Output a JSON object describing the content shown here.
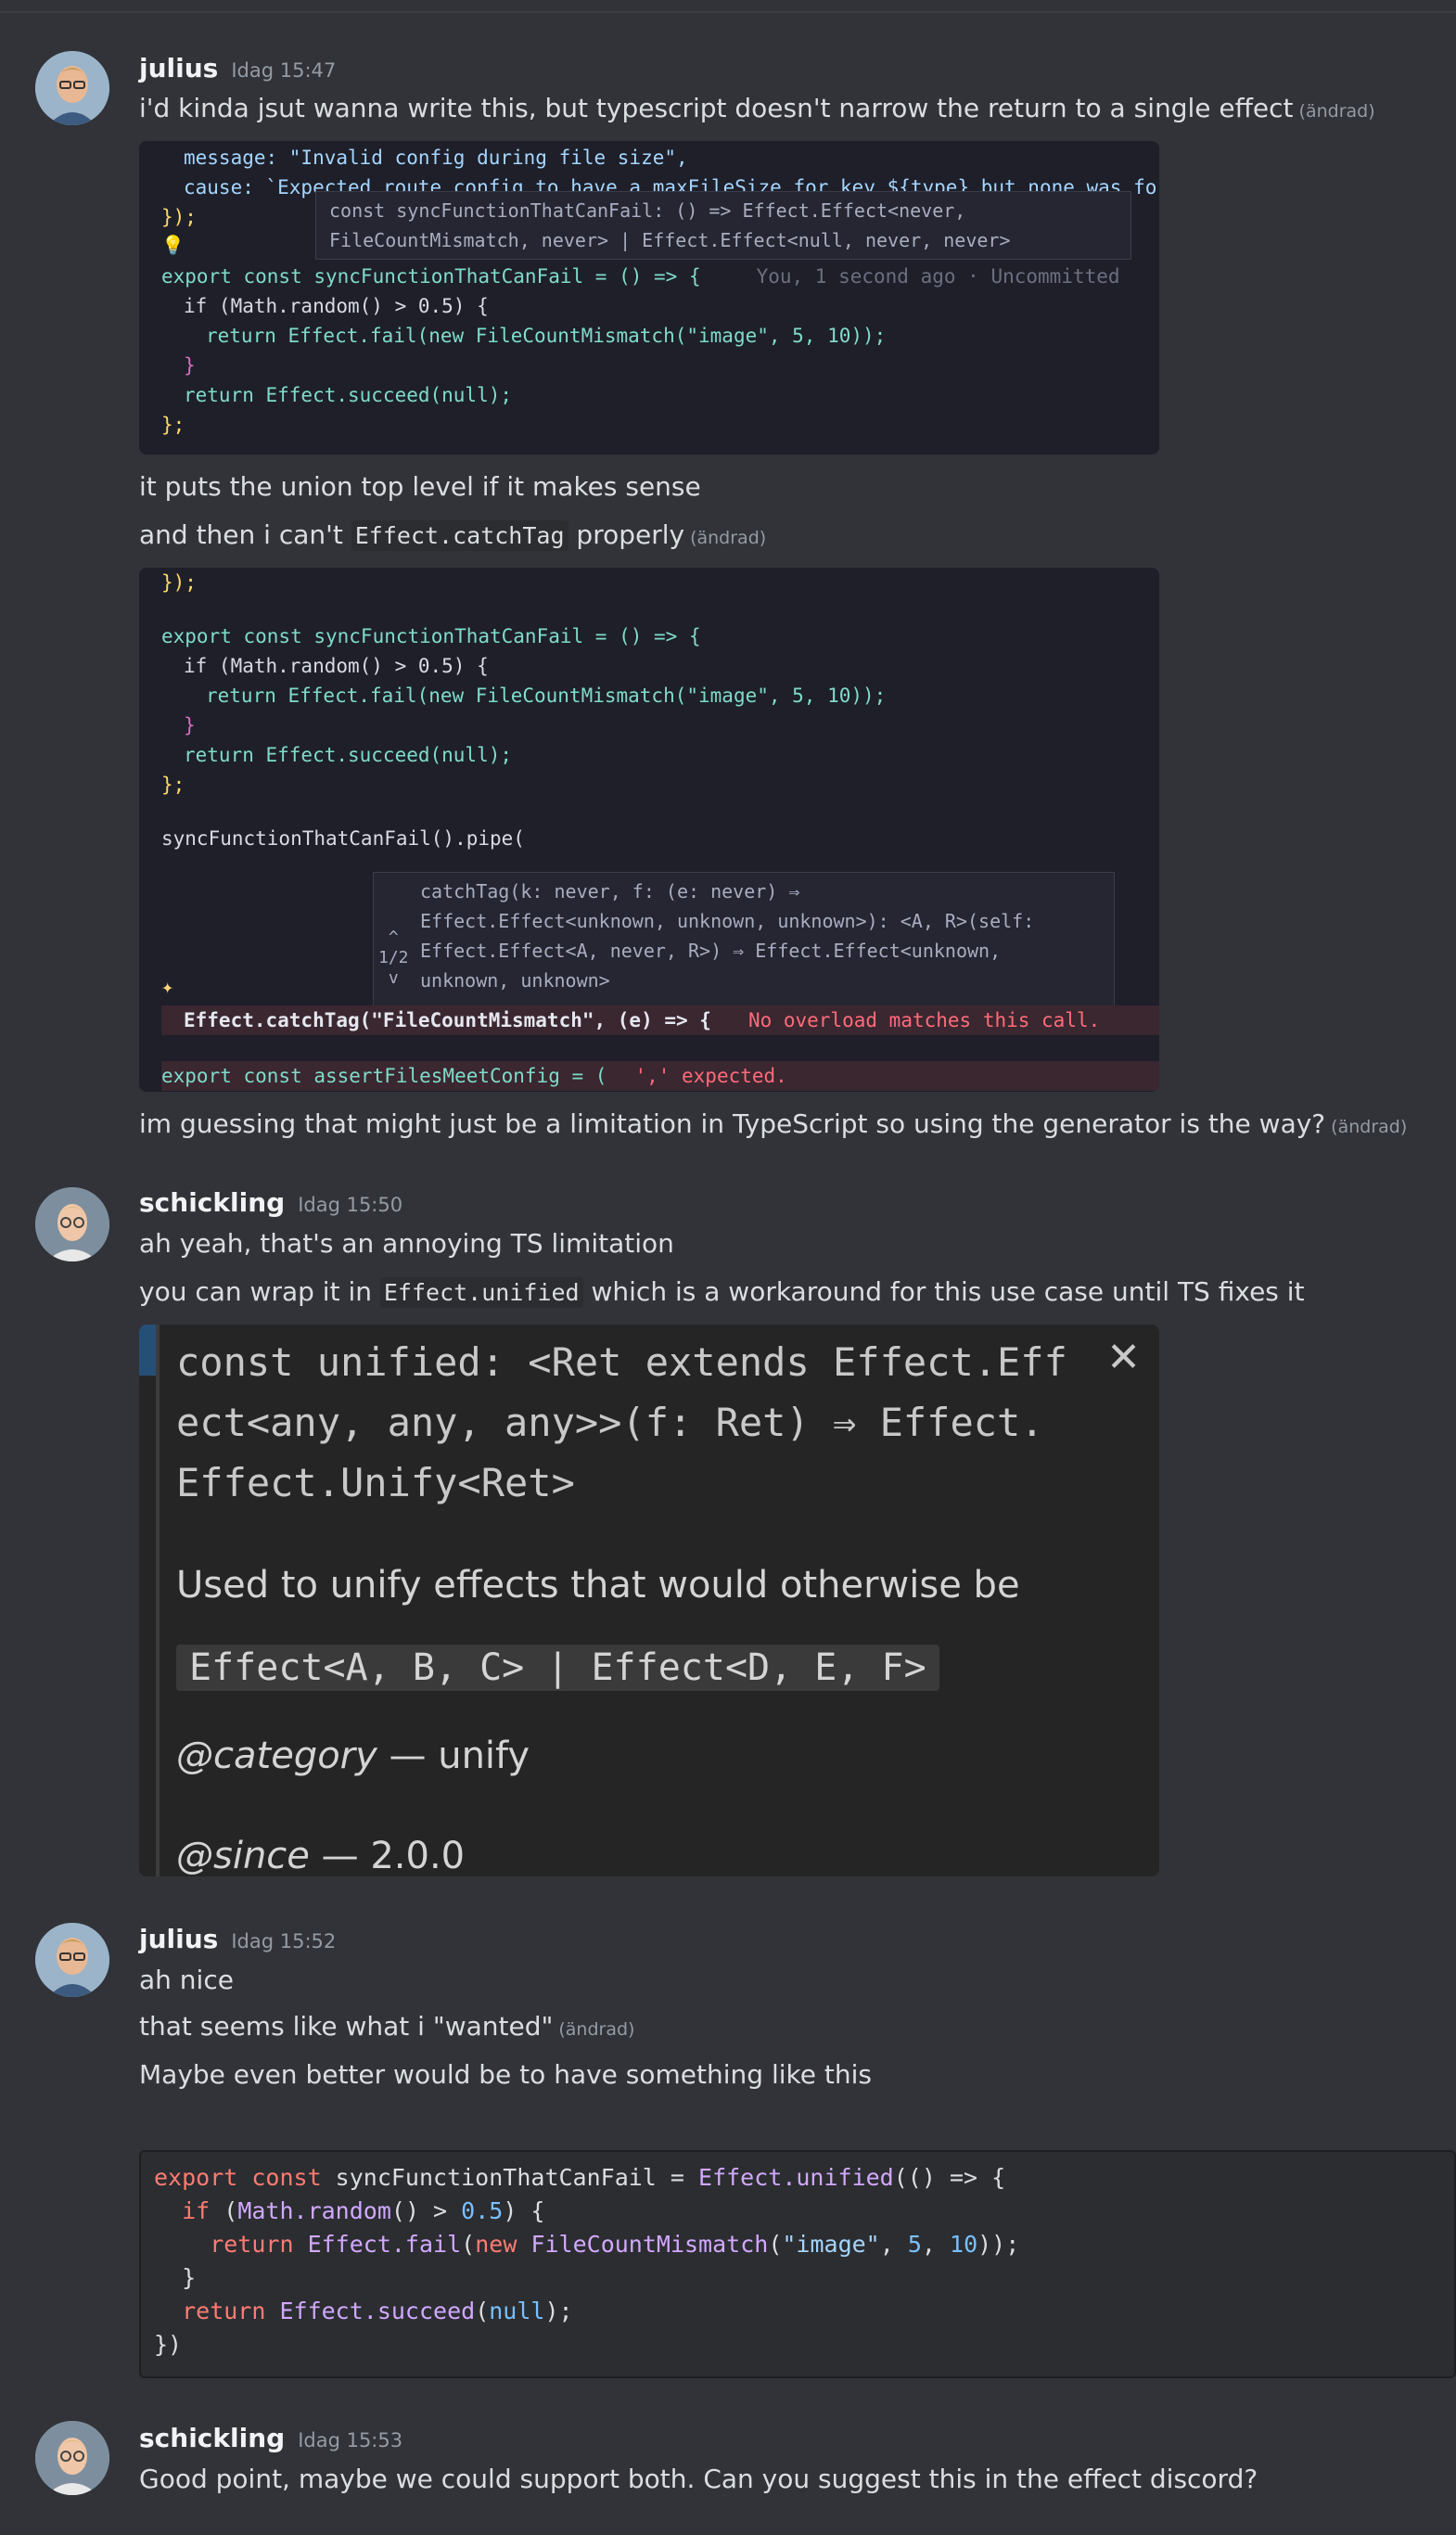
{
  "messages": [
    {
      "author": "julius",
      "timestamp": "Idag 15:47",
      "lines": [
        {
          "text": "i'd kinda jsut wanna write this, but typescript doesn't narrow the return to a single effect",
          "edited": "(ändrad)"
        },
        {
          "text": "it puts the union top level if it makes sense",
          "edited": ""
        },
        {
          "before": "and then i can't ",
          "code": "Effect.catchTag",
          "after": " properly",
          "edited": "(ändrad)"
        },
        {
          "text": "im guessing that might just be a limitation in TypeScript so using the generator is the way?",
          "edited": "(ändrad)"
        }
      ]
    },
    {
      "author": "schickling",
      "timestamp": "Idag 15:50",
      "lines": [
        {
          "text": "ah yeah, that's an annoying TS limitation"
        },
        {
          "before": "you can wrap it in ",
          "code": "Effect.unified",
          "after": " which is a workaround for this use case until TS fixes it"
        }
      ]
    },
    {
      "author": "julius",
      "timestamp": "Idag 15:52",
      "lines": [
        {
          "text": "ah nice"
        },
        {
          "text": "that seems like what i \"wanted\"",
          "edited": "(ändrad)"
        },
        {
          "text": "Maybe even better would be to have something like this"
        }
      ]
    },
    {
      "author": "schickling",
      "timestamp": "Idag 15:53",
      "lines": [
        {
          "text": "Good point, maybe we could support both. Can you suggest this in the effect discord?"
        }
      ]
    }
  ],
  "shot1": {
    "l1": "message: \"Invalid config during file size\",",
    "l2": "cause: `Expected route config to have a maxFileSize for key ${type} but none was fo",
    "l3": "});",
    "tip1": "const syncFunctionThatCanFail: () => Effect.Effect<never,",
    "tip2": "FileCountMismatch, never> | Effect.Effect<null, never, never>",
    "l4": "export const syncFunctionThatCanFail = () => {",
    "blame": "You, 1 second ago · Uncommitted",
    "l5": "if (Math.random() > 0.5) {",
    "l6": "return Effect.fail(new FileCountMismatch(\"image\", 5, 10));",
    "l7": "}",
    "l8": "return Effect.succeed(null);",
    "l9": "};"
  },
  "shot2": {
    "l1": "});",
    "l2": "export const syncFunctionThatCanFail = () => {",
    "l3": "if (Math.random() > 0.5) {",
    "l4": "return Effect.fail(new FileCountMismatch(\"image\", 5, 10));",
    "l5": "}",
    "l6": "return Effect.succeed(null);",
    "l7": "};",
    "l8": "syncFunctionThatCanFail().pipe(",
    "tip1": "catchTag(k: never, f: (e: never) ⇒",
    "tip2": "Effect.Effect<unknown, unknown, unknown>): <A, R>(self:",
    "tip3": "Effect.Effect<A, never, R>) ⇒ Effect.Effect<unknown,",
    "tip4": "unknown, unknown>",
    "pager": "1/2",
    "l9": "Effect.catchTag(\"FileCountMismatch\", (e) => {",
    "err": "No overload matches this call.",
    "l10": "export const assertFilesMeetConfig = (",
    "err2": "',' expected."
  },
  "doc": {
    "sig": "const unified: <Ret extends Effect.Eff\nect<any, any, any>>(f: Ret) ⇒ Effect.\nEffect.Unify<Ret>",
    "close": "✕",
    "desc": "Used to unify effects that would otherwise be",
    "chip": "Effect<A, B, C> | Effect<D, E, F>",
    "tag1_name": "@category",
    "tag1_val": " — unify",
    "tag2_name": "@since",
    "tag2_val": " — 2.0.0"
  },
  "codeblock": {
    "l1": "export const syncFunctionThatCanFail = Effect.unified(() => {",
    "l2": "  if (Math.random() > 0.5) {",
    "l3": "    return Effect.fail(new FileCountMismatch(\"image\", 5, 10));",
    "l4": "  }",
    "l5": "  return Effect.succeed(null);",
    "l6": "})"
  }
}
